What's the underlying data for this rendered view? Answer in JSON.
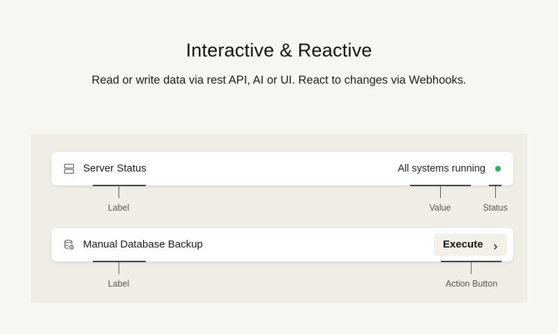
{
  "header": {
    "title": "Interactive & Reactive",
    "subtitle": "Read or write data via rest API, AI or UI. React to changes via Webhooks."
  },
  "cards": {
    "server_status": {
      "icon": "server-icon",
      "label": "Server Status",
      "value": "All systems running",
      "status_color": "#22b35a"
    },
    "backup": {
      "icon": "database-backup-icon",
      "label": "Manual Database Backup",
      "button_label": "Execute",
      "button_icon": "chevron-right-icon"
    }
  },
  "annotations": {
    "label_1": "Label",
    "value": "Value",
    "status": "Status",
    "label_2": "Label",
    "action_button": "Action Button"
  },
  "colors": {
    "background": "#f6f6f2",
    "panel": "#efeee6",
    "status_green": "#22b35a"
  }
}
